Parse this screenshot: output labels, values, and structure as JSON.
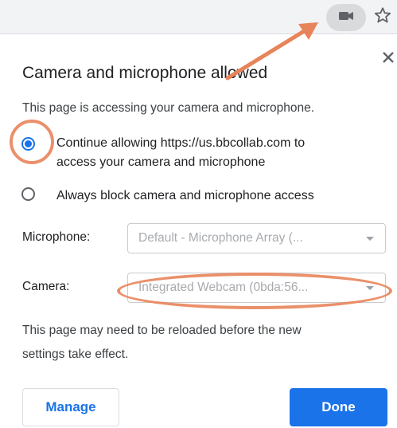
{
  "toolbar": {
    "camera_icon": "video-camera-icon",
    "star_icon": "star-outline-icon"
  },
  "dialog": {
    "title": "Camera and microphone allowed",
    "description": "This page is accessing your camera and microphone.",
    "options": [
      {
        "lines": [
          "Continue allowing https://us.bbcollab.com to",
          "access your camera and microphone"
        ],
        "checked": true
      },
      {
        "lines": [
          "Always block camera and microphone access"
        ],
        "checked": false
      }
    ],
    "microphone": {
      "label": "Microphone:",
      "value": "Default - Microphone Array (..."
    },
    "camera": {
      "label": "Camera:",
      "value": "Integrated Webcam (0bda:56..."
    },
    "notice_lines": [
      "This page may need to be reloaded before the new",
      "settings take effect."
    ],
    "manage_label": "Manage",
    "done_label": "Done"
  },
  "colors": {
    "accent": "#1a73e8",
    "annotation": "#e8845a"
  }
}
